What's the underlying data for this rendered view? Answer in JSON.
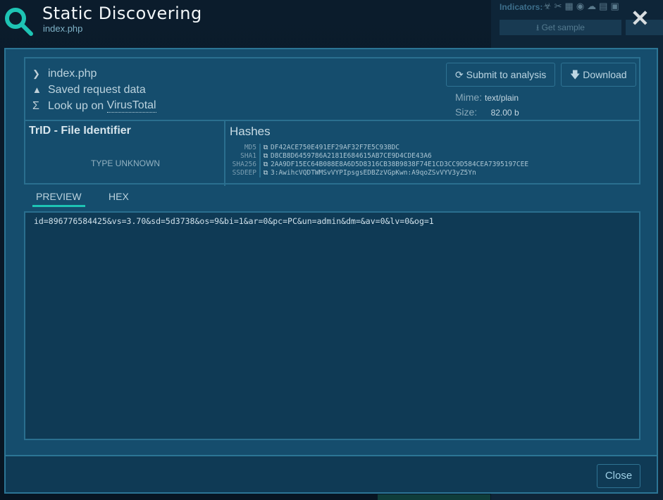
{
  "header": {
    "title": "Static Discovering",
    "subtitle": "index.php",
    "icon": "search-icon",
    "close_icon": "close-icon"
  },
  "background": {
    "indicators_label": "Indicators:",
    "get_sample": "Get sample"
  },
  "file": {
    "name": "index.php",
    "saved": "Saved request data",
    "lookup_prefix": "Look up on ",
    "lookup_link": "VirusTotal"
  },
  "actions": {
    "submit": "Submit to analysis",
    "download": "Download"
  },
  "meta": {
    "mime_label": "Mime:",
    "mime": "text/plain",
    "size_label": "Size:",
    "size": "82.00 b"
  },
  "trid": {
    "title": "TrID - File Identifier",
    "value": "TYPE UNKNOWN"
  },
  "hashes": {
    "title": "Hashes",
    "rows": [
      {
        "k": "MD5",
        "v": "DF42ACE750E491EF29AF32F7E5C93BDC"
      },
      {
        "k": "SHA1",
        "v": "D8CB8D6459786A2181E684615AB7CE9D4CDE43A6"
      },
      {
        "k": "SHA256",
        "v": "2AA9DF15EC64B088E8A6D5D8316CB38B9838F74E1CD3CC9D584CEA7395197CEE"
      },
      {
        "k": "SSDEEP",
        "v": "3:AwihcVQDTWMSvVYPIpsgsEDBZzVGpKwn:A9qoZSvVYV3yZ5Yn"
      }
    ]
  },
  "tabs": [
    {
      "label": "PREVIEW",
      "active": true
    },
    {
      "label": "HEX",
      "active": false
    }
  ],
  "preview": "id=896776584425&vs=3.70&sd=5d3738&os=9&bi=1&ar=0&pc=PC&un=admin&dm=&av=0&lv=0&og=1",
  "footer": {
    "close": "Close"
  },
  "colors": {
    "accent": "#1ec4b4",
    "modal": "#154d6d",
    "border": "#2a6f8f"
  }
}
